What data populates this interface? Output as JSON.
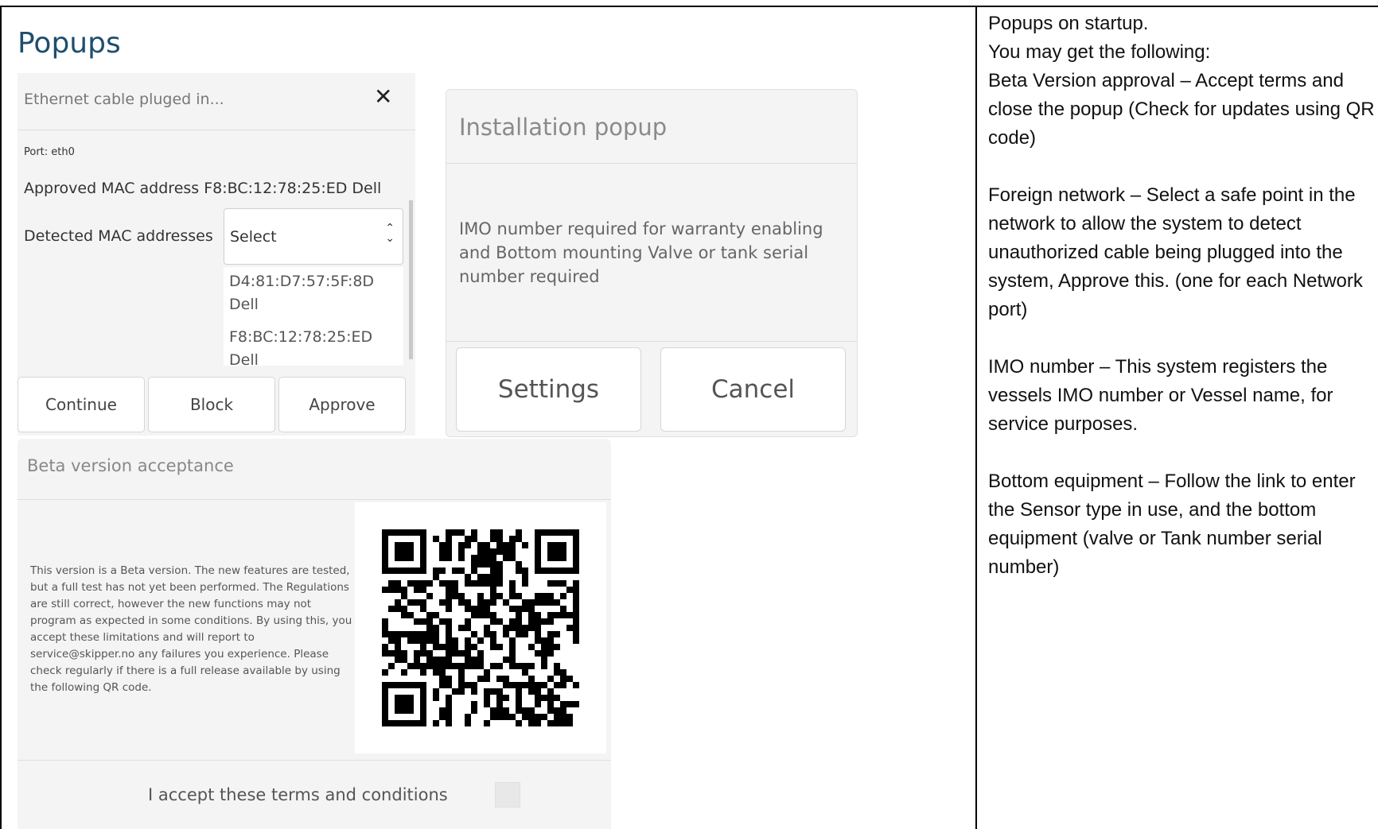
{
  "page": {
    "title": "Popups"
  },
  "ethernet_popup": {
    "title": "Ethernet cable pluged in...",
    "close_icon": "close-icon",
    "port": "Port: eth0",
    "approved": "Approved MAC address F8:BC:12:78:25:ED Dell",
    "detected_label": "Detected MAC addresses",
    "select_value": "Select",
    "options": [
      {
        "mac": "D4:81:D7:57:5F:8D",
        "vendor": "Dell"
      },
      {
        "mac": "F8:BC:12:78:25:ED",
        "vendor": "Dell"
      }
    ],
    "buttons": {
      "continue": "Continue",
      "block": "Block",
      "approve": "Approve"
    }
  },
  "installation_popup": {
    "title": "Installation popup",
    "body": "IMO number required for warranty enabling and Bottom mounting Valve or tank serial number required",
    "buttons": {
      "settings": "Settings",
      "cancel": "Cancel"
    }
  },
  "beta_popup": {
    "title": "Beta version acceptance",
    "body": "This version is a Beta version. The new features are tested, but a full test has not yet been performed. The Regulations are still correct, however the new functions may not program as expected in some conditions. By using this, you accept these limitations and will report to service@skipper.no any failures you experience. Please check regularly if there is a full release available by using the following QR code.",
    "qr_icon": "qr-code",
    "accept_label": "I accept these terms and conditions",
    "accept_checked": false
  },
  "notes": {
    "intro_1": "Popups on startup.",
    "intro_2": "You may get the following:",
    "beta": "Beta Version approval – Accept terms and close the popup (Check for updates using QR code)",
    "foreign": "Foreign network – Select a safe point in the network to allow the system to detect unauthorized cable being plugged into the system, Approve this. (one for each Network port)",
    "imo": "IMO number – This system registers the vessels IMO number or Vessel name, for service purposes.",
    "bottom": "Bottom equipment – Follow the link to enter the Sensor type in use, and the bottom equipment (valve or Tank number serial number)"
  }
}
